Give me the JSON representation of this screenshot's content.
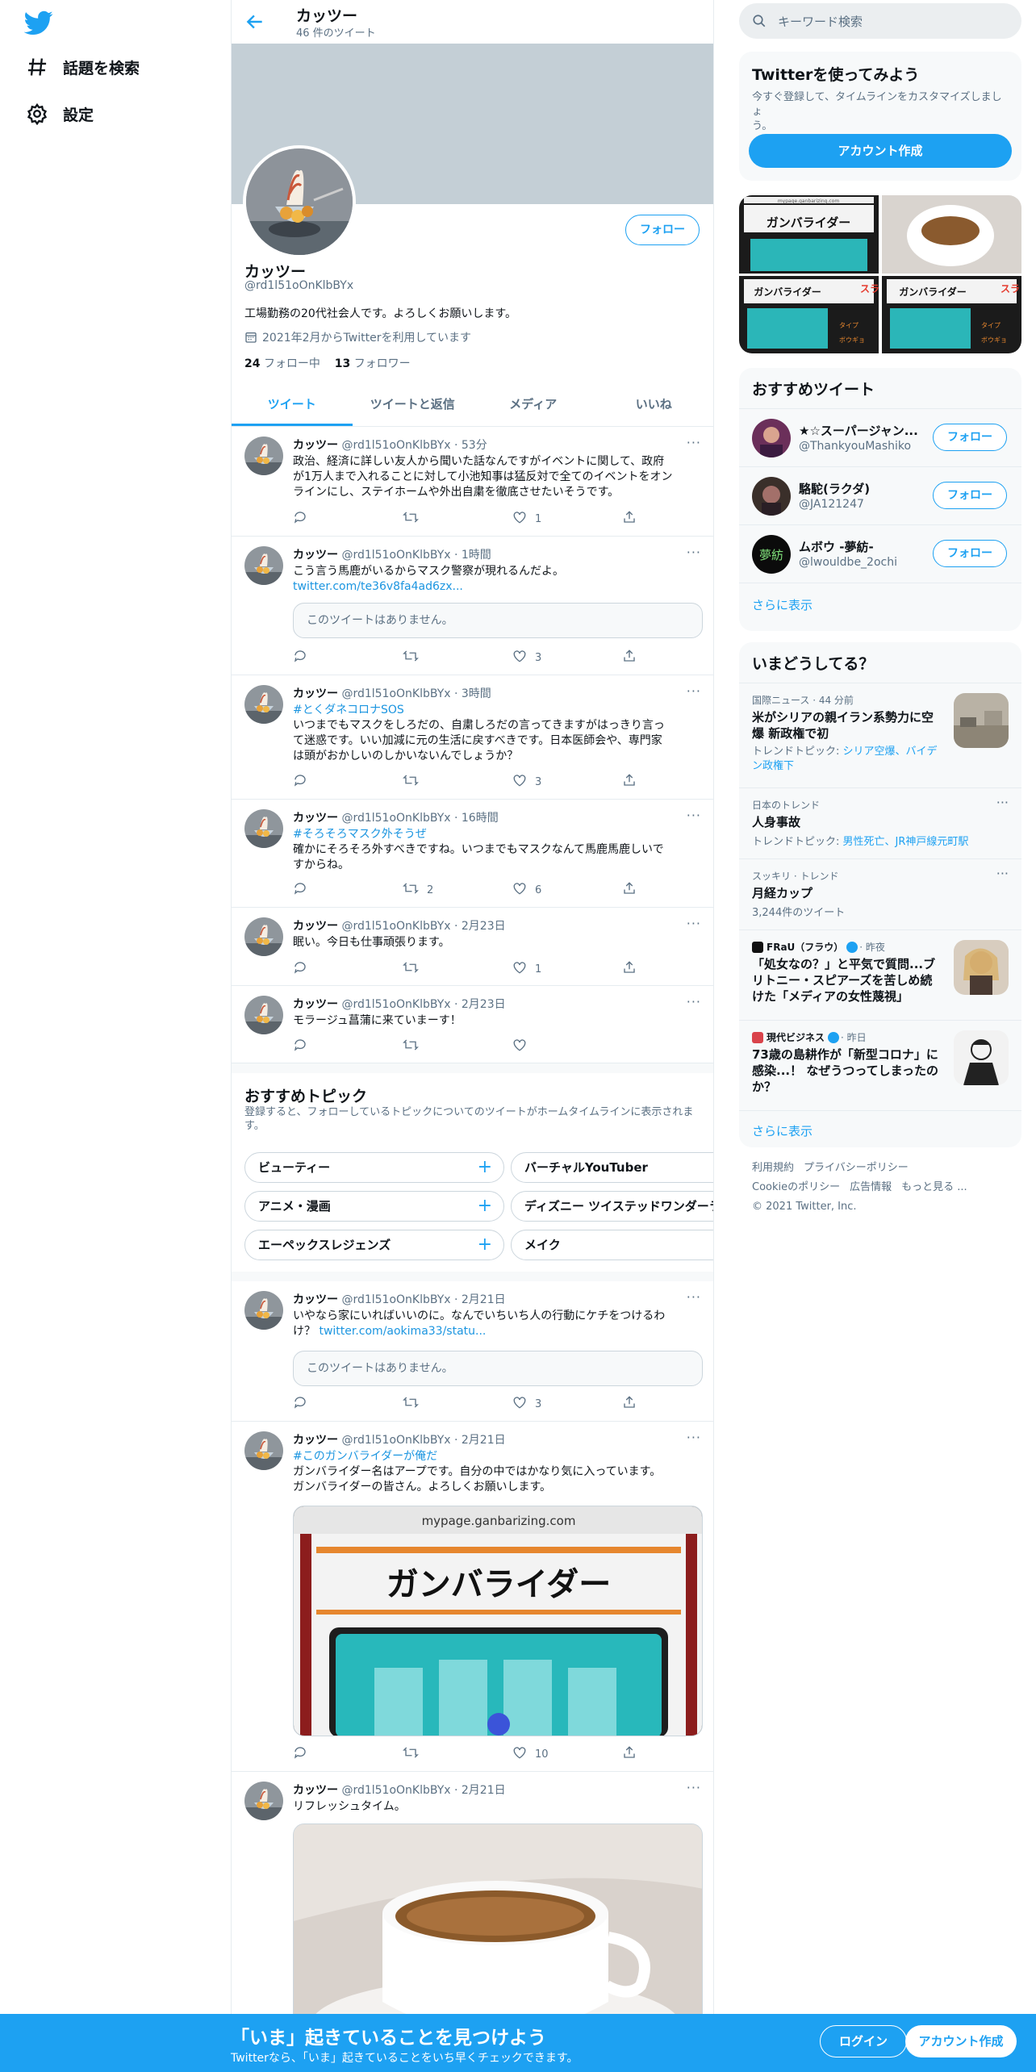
{
  "nav": {
    "logo_icon": "twitter-bird-icon",
    "explore_label": "話題を検索",
    "settings_label": "設定"
  },
  "header": {
    "name": "カッツー",
    "tweet_count": "46 件のツイート"
  },
  "profile": {
    "name": "カッツー",
    "handle": "@rd1l51oOnKlbBYx",
    "bio": "工場勤務の20代社会人です。よろしくお願いします。",
    "joined": "2021年2月からTwitterを利用しています",
    "following_count": "24",
    "following_label": "フォロー中",
    "followers_count": "13",
    "followers_label": "フォロワー",
    "follow_button": "フォロー"
  },
  "tabs": [
    "ツイート",
    "ツイートと返信",
    "メディア",
    "いいね"
  ],
  "tweets": [
    {
      "name": "カッツー",
      "meta": "@rd1l51oOnKlbBYx · 53分",
      "lines": [
        "政治、経済に詳しい友人から聞いた話なんですがイベントに関して、政府",
        "が1万人まで入れることに対して小池知事は猛反対で全てのイベントをオン",
        "ラインにし、ステイホームや外出自粛を徹底させたいそうです。"
      ],
      "likes": "1"
    },
    {
      "name": "カッツー",
      "meta": "@rd1l51oOnKlbBYx · 1時間",
      "lines": [
        "こう言う馬鹿がいるからマスク警察が現れるんだよ。"
      ],
      "link": "twitter.com/te36v8fa4ad6zx...",
      "quote": "このツイートはありません。",
      "likes": "3"
    },
    {
      "name": "カッツー",
      "meta": "@rd1l51oOnKlbBYx · 3時間",
      "hashtag": "#とくダネコロナSOS",
      "lines": [
        "いつまでもマスクをしろだの、自粛しろだの言ってきますがはっきり言っ",
        "て迷惑です。いい加減に元の生活に戻すべきです。日本医師会や、専門家",
        "は頭がおかしいのしかいないんでしょうか？"
      ],
      "likes": "3"
    },
    {
      "name": "カッツー",
      "meta": "@rd1l51oOnKlbBYx · 16時間",
      "hashtag": "#そろそろマスク外そうぜ",
      "lines": [
        "確かにそろそろ外すべきですね。いつまでもマスクなんて馬鹿馬鹿しいで",
        "すからね。"
      ],
      "retweets": "2",
      "likes": "6"
    },
    {
      "name": "カッツー",
      "meta": "@rd1l51oOnKlbBYx · 2月23日",
      "lines": [
        "眠い。今日も仕事頑張ります。"
      ],
      "likes": "1"
    },
    {
      "name": "カッツー",
      "meta": "@rd1l51oOnKlbBYx · 2月23日",
      "lines": [
        "モラージュ菖蒲に来ていまーす！"
      ]
    },
    {
      "name": "カッツー",
      "meta": "@rd1l51oOnKlbBYx · 2月21日",
      "lines": [
        "いやなら家にいればいいのに。なんでいちいち人の行動にケチをつけるわ"
      ],
      "line2_prefix": "け？ ",
      "link": "twitter.com/aokima33/statu...",
      "quote": "このツイートはありません。",
      "likes": "3"
    },
    {
      "name": "カッツー",
      "meta": "@rd1l51oOnKlbBYx · 2月21日",
      "hashtag": "#このガンバライダーが俺だ",
      "lines": [
        "ガンバライダー名はアープです。自分の中ではかなり気に入っています。",
        "ガンバライダーの皆さん。よろしくお願いします。"
      ],
      "image_url_text": "mypage.ganbarizing.com",
      "image_title": "ガンバライダー",
      "likes": "10"
    },
    {
      "name": "カッツー",
      "meta": "@rd1l51oOnKlbBYx · 2月21日",
      "lines": [
        "リフレッシュタイム。"
      ]
    }
  ],
  "topics": {
    "title": "おすすめトピック",
    "subtitle_1": "登録すると、フォローしているトピックについてのツイートがホームタイムラインに表示されま",
    "subtitle_2": "す。",
    "items": [
      "ビューティー",
      "バーチャルYouTuber",
      "アニメ・漫画",
      "ディズニー ツイステッドワンダーランド",
      "エーペックスレジェンズ",
      "メイク"
    ]
  },
  "sidebar": {
    "search_placeholder": "キーワード検索",
    "signup_card": {
      "title": "Twitterを使ってみよう",
      "subtitle_1": "今すぐ登録して、タイムラインをカスタマイズしましょ",
      "subtitle_2": "う。",
      "button": "アカウント作成"
    },
    "media_text": [
      "mypage.ganbarizing.com",
      "ガンバライダー",
      "ガンバライダー",
      "ガンバライダー",
      "タイプ",
      "ボウギョ",
      "タイプ",
      "ボウギョ",
      "スラ",
      "スラ"
    ],
    "recommended": {
      "title": "おすすめツイート",
      "users": [
        {
          "name": "★☆スーパージャン...",
          "handle": "@ThankyouMashiko"
        },
        {
          "name": "駱駝(ラクダ)",
          "handle": "@JA121247"
        },
        {
          "name": "ムボウ -夢紡-",
          "handle": "@lwouldbe_2ochi",
          "avatar_text": "夢紡"
        }
      ],
      "follow_label": "フォロー",
      "show_more": "さらに表示"
    },
    "trends": {
      "title": "いまどうしてる？",
      "items": [
        {
          "meta": "国際ニュース · 44 分前",
          "title_1": "米がシリアの親イラン系勢力に空",
          "title_2": "爆 新政権で初",
          "sub_prefix": "トレンドトピック: ",
          "sub_link_1": "シリア空爆、バイデ",
          "sub_link_2": "ン政権下"
        },
        {
          "meta": "日本のトレンド",
          "title_1": "人身事故",
          "sub_prefix": "トレンドトピック: ",
          "sub_link_1": "男性死亡、JR神戸線元町駅"
        },
        {
          "meta": "スッキリ · トレンド",
          "title_1": "月経カップ",
          "sub": "3,244件のツイート"
        },
        {
          "meta_source": "FRaU（フラウ）",
          "meta_time": " · 昨夜",
          "title_1": "「処女なの？」と平気で質問...ブ",
          "title_2": "リトニー・スピアーズを苦しめ続",
          "title_3": "けた「メディアの女性蔑視」"
        },
        {
          "meta_source": "現代ビジネス",
          "meta_time": " · 昨日",
          "title_1": "73歳の島耕作が「新型コロナ」に",
          "title_2": "感染...！ なぜうつってしまったの",
          "title_3": "か？"
        }
      ],
      "show_more": "さらに表示"
    },
    "footer": {
      "links_1": [
        "利用規約",
        "プライバシーポリシー"
      ],
      "links_2": [
        "Cookieのポリシー",
        "広告情報",
        "もっと見る ..."
      ],
      "copyright": "© 2021 Twitter, Inc."
    }
  },
  "bottom_bar": {
    "title": "「いま」起きていることを見つけよう",
    "subtitle": "Twitterなら、「いま」起きていることをいち早くチェックできます。",
    "login": "ログイン",
    "signup": "アカウント作成"
  },
  "colors": {
    "accent": "#1da1f2",
    "banner": "#c4cfd6",
    "muted": "#5b7083"
  }
}
